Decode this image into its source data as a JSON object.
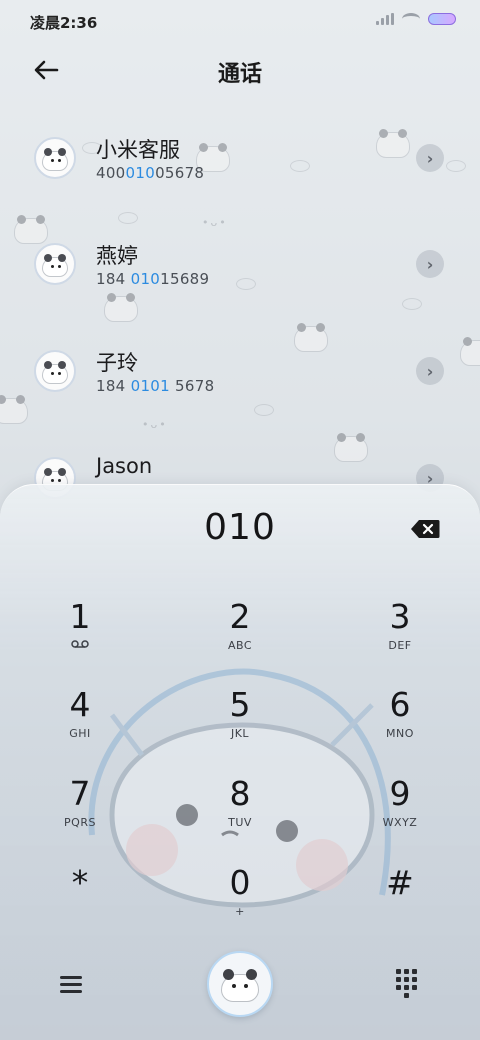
{
  "status_bar": {
    "time": "凌晨2:36"
  },
  "header": {
    "title": "通话"
  },
  "contacts": [
    {
      "name": "小米客服",
      "number_pre": "400",
      "number_hl": "010",
      "number_post": "05678"
    },
    {
      "name": "燕婷",
      "number_pre": "184 ",
      "number_hl": "010",
      "number_post": "15689"
    },
    {
      "name": "子玲",
      "number_pre": "184 ",
      "number_hl": "0101",
      "number_post": " 5678"
    },
    {
      "name": "Jason",
      "number_pre": "",
      "number_hl": "",
      "number_post": ""
    }
  ],
  "dialer": {
    "input": "010",
    "keys": [
      {
        "digit": "1",
        "sub": ""
      },
      {
        "digit": "2",
        "sub": "ABC"
      },
      {
        "digit": "3",
        "sub": "DEF"
      },
      {
        "digit": "4",
        "sub": "GHI"
      },
      {
        "digit": "5",
        "sub": "JKL"
      },
      {
        "digit": "6",
        "sub": "MNO"
      },
      {
        "digit": "7",
        "sub": "PQRS"
      },
      {
        "digit": "8",
        "sub": "TUV"
      },
      {
        "digit": "9",
        "sub": "WXYZ"
      },
      {
        "digit": "*",
        "sub": ""
      },
      {
        "digit": "0",
        "sub": "+"
      },
      {
        "digit": "#",
        "sub": ""
      }
    ]
  },
  "icons": {
    "back": "arrow-left-icon",
    "backspace": "backspace-icon",
    "voicemail": "voicemail-icon",
    "menu": "menu-icon",
    "call": "call-icon",
    "keypad": "keypad-icon",
    "chevron": "chevron-right-icon"
  },
  "colors": {
    "highlight": "#2c8be0",
    "text": "#1b1b1d"
  }
}
